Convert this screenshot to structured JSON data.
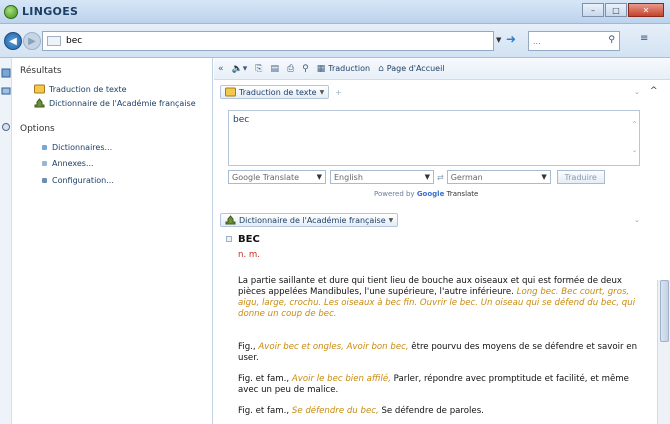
{
  "app": {
    "title": "LINGOES"
  },
  "window_controls": {
    "minimize": "–",
    "maximize": "□",
    "close": "✕"
  },
  "address": {
    "query": "bec",
    "side_placeholder": "..."
  },
  "sidebar": {
    "results_title": "Résultats",
    "results": [
      {
        "label": "Traduction de texte"
      },
      {
        "label": "Dictionnaire de l'Académie française"
      }
    ],
    "options_title": "Options",
    "options": [
      {
        "label": "Dictionnaires..."
      },
      {
        "label": "Annexes..."
      },
      {
        "label": "Configuration..."
      }
    ]
  },
  "toolbar": {
    "translation_label": "Traduction",
    "home_label": "Page d'Accueil"
  },
  "text_translation": {
    "tab_label": "Traduction de texte",
    "input_text": "bec",
    "engine": "Google Translate",
    "source_lang": "English",
    "target_lang": "German",
    "translate_button": "Traduire",
    "powered_by": "Powered by",
    "powered_brand": "Google",
    "powered_suffix": "Translate"
  },
  "dictionary": {
    "tab_label": "Dictionnaire de l'Académie française",
    "headword": "BEC",
    "part_of_speech": "n. m.",
    "p1_text": "La partie saillante et dure qui tient lieu de bouche aux oiseaux et qui est formée de deux pièces appelées Mandibules, l'une supérieure, l'autre inférieure.",
    "p1_examples": "Long bec. Bec court, gros, aigu, large, crochu. Les oiseaux à bec fin. Ouvrir le bec. Un oiseau qui se défend du bec, qui donne un coup de bec.",
    "p2_prefix": "Fig.,",
    "p2_examples": "Avoir bec et ongles, Avoir bon bec,",
    "p2_text": "être pourvu des moyens de se défendre et savoir en user.",
    "p3_prefix": "Fig. et fam.,",
    "p3_examples": "Avoir le bec bien affilé,",
    "p3_text": "Parler, répondre avec promptitude et facilité, et même avec un peu de malice.",
    "p4_prefix": "Fig. et fam.,",
    "p4_examples": "Se défendre du bec,",
    "p4_text": "Se défendre de paroles."
  }
}
